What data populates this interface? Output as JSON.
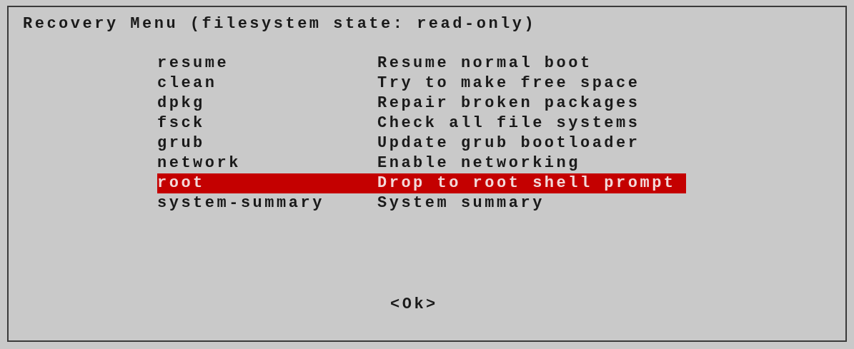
{
  "title": "Recovery Menu (filesystem state: read-only)",
  "menu_items": [
    {
      "name": "resume",
      "description": "Resume normal boot",
      "selected": false
    },
    {
      "name": "clean",
      "description": "Try to make free space",
      "selected": false
    },
    {
      "name": "dpkg",
      "description": "Repair broken packages",
      "selected": false
    },
    {
      "name": "fsck",
      "description": "Check all file systems",
      "selected": false
    },
    {
      "name": "grub",
      "description": "Update grub bootloader",
      "selected": false
    },
    {
      "name": "network",
      "description": "Enable networking",
      "selected": false
    },
    {
      "name": "root",
      "description": "Drop to root shell prompt",
      "selected": true
    },
    {
      "name": "system-summary",
      "description": "System summary",
      "selected": false
    }
  ],
  "ok_button": "<Ok>"
}
